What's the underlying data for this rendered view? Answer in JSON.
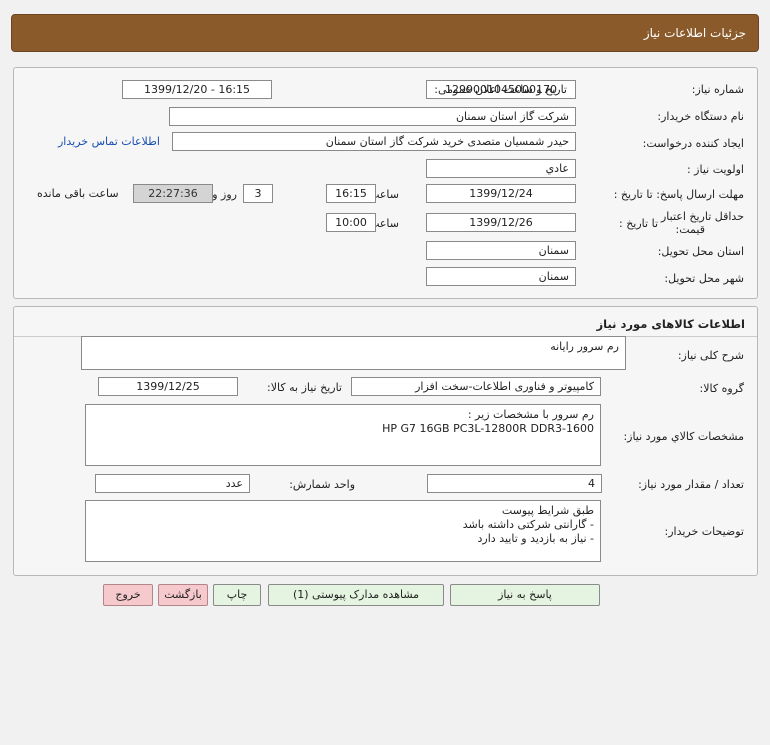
{
  "header": {
    "title": "جزئیات اطلاعات نیاز"
  },
  "info": {
    "need_number_label": "شماره نیاز:",
    "need_number": "1299001045000170",
    "announce_label": "تاریخ و ساعت اعلان عمومی:",
    "announce_value": "1399/12/20 - 16:15",
    "buyer_org_label": "نام دستگاه خریدار:",
    "buyer_org": "شرکت گاز استان سمنان",
    "requester_label": "ایجاد کننده درخواست:",
    "requester": "حیدر شمسیان متصدی خرید شرکت گاز استان سمنان",
    "contact_link": "اطلاعات تماس خریدار",
    "priority_label": "اولویت نیاز :",
    "priority": "عادي",
    "deadline_label": "مهلت ارسال پاسخ: تا تاریخ :",
    "deadline_date": "1399/12/24",
    "deadline_time_label": "ساعت",
    "deadline_time": "16:15",
    "days": "3",
    "days_label": "روز و",
    "remaining_time": "22:27:36",
    "remaining_label": "ساعت باقی مانده",
    "price_valid_label_1": "حداقل تاریخ اعتبار",
    "price_valid_label_2": "قیمت:",
    "price_valid_to_label": "تا تاریخ :",
    "price_valid_date": "1399/12/26",
    "price_valid_time_label": "ساعت",
    "price_valid_time": "10:00",
    "province_label": "استان محل تحویل:",
    "province": "سمنان",
    "city_label": "شهر محل تحویل:",
    "city": "سمنان"
  },
  "goods": {
    "section_title": "اطلاعات کالاهای مورد نیاز",
    "summary_label": "شرح کلی نیاز:",
    "summary": "رم سرور رایانه",
    "group_label": "گروه کالا:",
    "group": "کامپیوتر و فناوری اطلاعات-سخت افزار",
    "need_date_label": "تاریخ نیاز به کالا:",
    "need_date": "1399/12/25",
    "specs_label": "مشخصات کالاي مورد نیاز:",
    "specs_line1": "رم سرور با مشخصات زیر :",
    "specs_line2": "HP G7 16GB PC3L-12800R DDR3-1600",
    "qty_label": "تعداد / مقدار مورد نیاز:",
    "qty": "4",
    "unit_label": "واحد شمارش:",
    "unit": "عدد",
    "notes_label": "توضیحات خریدار:",
    "notes_line1": "طبق شرایط پیوست",
    "notes_line2": "- گارانتی شرکتی داشته باشد",
    "notes_line3": "- نیاز به بازدید و تایید دارد"
  },
  "buttons": {
    "reply": "پاسخ به نیاز",
    "attachments": "مشاهده مدارک پیوستی (1)",
    "print": "چاپ",
    "back": "بازگشت",
    "exit": "خروج"
  }
}
